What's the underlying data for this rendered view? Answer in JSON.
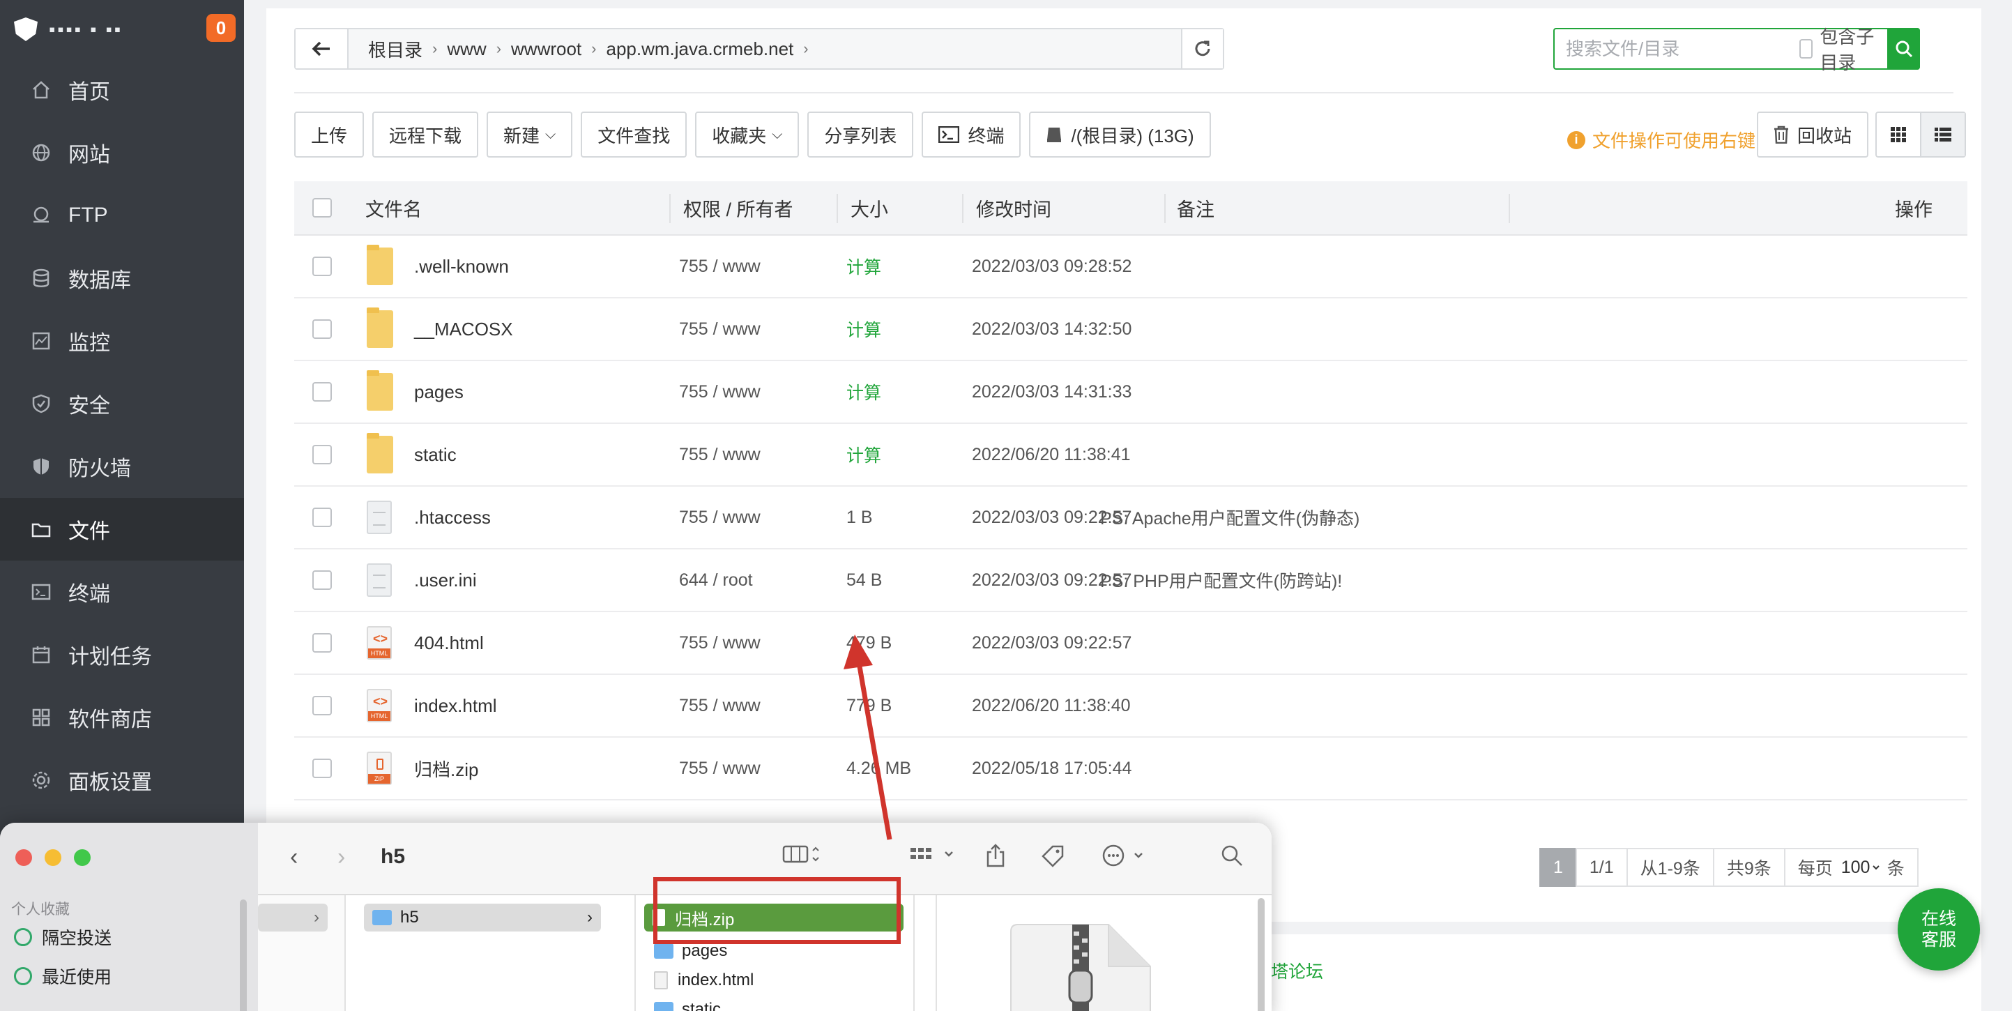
{
  "sidebar": {
    "logo_text": "▪▪▪▪ ▪ ▪▪",
    "badge": "0",
    "items": [
      {
        "label": "首页",
        "icon": "home-icon"
      },
      {
        "label": "网站",
        "icon": "globe-icon"
      },
      {
        "label": "FTP",
        "icon": "ftp-icon"
      },
      {
        "label": "数据库",
        "icon": "database-icon"
      },
      {
        "label": "监控",
        "icon": "monitor-icon"
      },
      {
        "label": "安全",
        "icon": "shield-check-icon"
      },
      {
        "label": "防火墙",
        "icon": "firewall-icon"
      },
      {
        "label": "文件",
        "icon": "folder-icon"
      },
      {
        "label": "终端",
        "icon": "terminal-icon"
      },
      {
        "label": "计划任务",
        "icon": "calendar-icon"
      },
      {
        "label": "软件商店",
        "icon": "apps-icon"
      },
      {
        "label": "面板设置",
        "icon": "gear-icon"
      }
    ]
  },
  "breadcrumb": [
    "根目录",
    "www",
    "wwwroot",
    "app.wm.java.crmeb.net"
  ],
  "search": {
    "placeholder": "搜索文件/目录",
    "include_sub": "包含子目录"
  },
  "toolbar": {
    "upload": "上传",
    "remote_download": "远程下载",
    "new": "新建",
    "find": "文件查找",
    "favorites": "收藏夹",
    "share_list": "分享列表",
    "terminal": "终端",
    "disk": "/(根目录) (13G)",
    "tip": "文件操作可使用右键",
    "recycle": "回收站"
  },
  "table": {
    "headers": {
      "name": "文件名",
      "perm": "权限 / 所有者",
      "size": "大小",
      "mtime": "修改时间",
      "note": "备注",
      "ops": "操作"
    },
    "rows": [
      {
        "type": "folder",
        "name": ".well-known",
        "perm": "755 / www",
        "size": "计算",
        "mtime": "2022/03/03 09:28:52",
        "note": ""
      },
      {
        "type": "folder",
        "name": "__MACOSX",
        "perm": "755 / www",
        "size": "计算",
        "mtime": "2022/03/03 14:32:50",
        "note": ""
      },
      {
        "type": "folder",
        "name": "pages",
        "perm": "755 / www",
        "size": "计算",
        "mtime": "2022/03/03 14:31:33",
        "note": ""
      },
      {
        "type": "folder",
        "name": "static",
        "perm": "755 / www",
        "size": "计算",
        "mtime": "2022/06/20 11:38:41",
        "note": ""
      },
      {
        "type": "file",
        "name": ".htaccess",
        "perm": "755 / www",
        "size": "1 B",
        "mtime": "2022/03/03 09:22:57",
        "note": "PS: Apache用户配置文件(伪静态)"
      },
      {
        "type": "file",
        "name": ".user.ini",
        "perm": "644 / root",
        "size": "54 B",
        "mtime": "2022/03/03 09:22:57",
        "note": "PS: PHP用户配置文件(防跨站)!"
      },
      {
        "type": "html",
        "name": "404.html",
        "perm": "755 / www",
        "size": "479 B",
        "mtime": "2022/03/03 09:22:57",
        "note": ""
      },
      {
        "type": "html",
        "name": "index.html",
        "perm": "755 / www",
        "size": "779 B",
        "mtime": "2022/06/20 11:38:40",
        "note": ""
      },
      {
        "type": "zip",
        "name": "归档.zip",
        "perm": "755 / www",
        "size": "4.26 MB",
        "mtime": "2022/05/18 17:05:44",
        "note": ""
      }
    ]
  },
  "pagination": {
    "current": "1",
    "total": "1/1",
    "range": "从1-9条",
    "count": "共9条",
    "per_page_label": "每页",
    "per_page": "100",
    "unit": "条"
  },
  "footer": {
    "forum": "宝塔论坛"
  },
  "online_service": {
    "line1": "在线",
    "line2": "客服"
  },
  "finder": {
    "title": "h5",
    "favorites_label": "个人收藏",
    "favorites": [
      "隔空投送",
      "最近使用"
    ],
    "col1_selected": "h5",
    "col2_selected": "归档.zip",
    "col2_items": [
      "pages",
      "index.html",
      "static"
    ]
  },
  "colors": {
    "accent": "#20a53a",
    "sidebar": "#383c42",
    "warning": "#f0a12e",
    "annotation": "#d0342c"
  }
}
